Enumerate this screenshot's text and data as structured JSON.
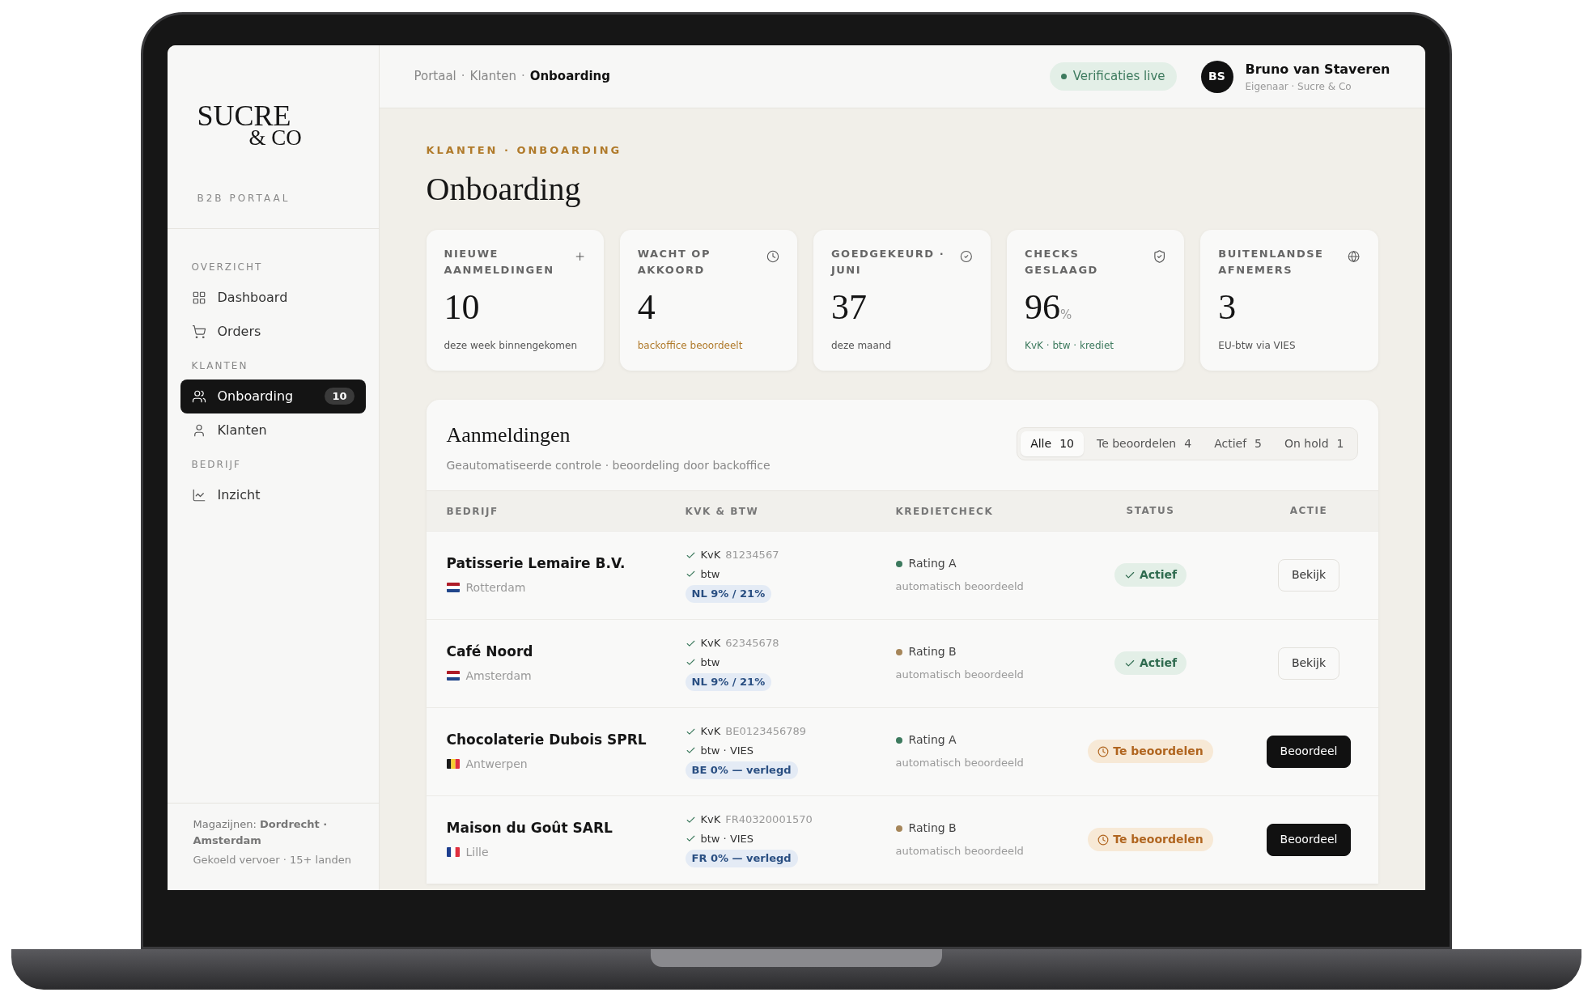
{
  "logo": {
    "line1": "SUCRE",
    "line2": "& CO"
  },
  "portal_label": "B2B PORTAAL",
  "sidebar": {
    "sections": [
      {
        "heading": "OVERZICHT",
        "items": [
          {
            "label": "Dashboard",
            "selected": false
          },
          {
            "label": "Orders",
            "selected": false
          }
        ]
      },
      {
        "heading": "KLANTEN",
        "items": [
          {
            "label": "Onboarding",
            "selected": true,
            "badge": "10"
          },
          {
            "label": "Klanten",
            "selected": false
          }
        ]
      },
      {
        "heading": "BEDRIJF",
        "items": [
          {
            "label": "Inzicht",
            "selected": false
          }
        ]
      }
    ],
    "footer": {
      "text": "Magazijnen: **Dordrecht · Amsterdam**",
      "subtext": "Gekoeld vervoer · 15+ landen"
    }
  },
  "header": {
    "breadcrumb": {
      "separator": "·",
      "items": [
        {
          "label": "Portaal",
          "current": false
        },
        {
          "label": "Klanten",
          "current": false
        },
        {
          "label": "Onboarding",
          "current": true
        }
      ]
    },
    "status_pill": "Verificaties live",
    "user": {
      "initials": "BS",
      "name": "Bruno van Staveren",
      "role": "Eigenaar · Sucre & Co"
    }
  },
  "page": {
    "eyebrow": "KLANTEN · ONBOARDING",
    "title": "Onboarding"
  },
  "stats": [
    {
      "label": "NIEUWE AANMELDINGEN",
      "value": "10",
      "note": "deze week binnengekomen",
      "kind": "muted"
    },
    {
      "label": "WACHT OP AKKOORD",
      "value": "4",
      "note": "backoffice beoordeelt",
      "kind": "warning"
    },
    {
      "label": "GOEDGEKEURD · JUNI",
      "value": "37",
      "note": "deze maand",
      "kind": "muted"
    },
    {
      "label": "CHECKS GESLAAGD",
      "value": "96",
      "unit": "%",
      "note": "KvK · btw · krediet",
      "kind": "success"
    },
    {
      "label": "BUITENLANDSE AFNEMERS",
      "value": "3",
      "note": "EU-btw via VIES",
      "kind": "muted"
    }
  ],
  "table": {
    "title": "Aanmeldingen",
    "subtitle": "Geautomatiseerde controle · beoordeling door backoffice",
    "filters": [
      {
        "label": "Alle",
        "count": "10",
        "selected": true
      },
      {
        "label": "Te beoordelen",
        "count": "4",
        "selected": false
      },
      {
        "label": "Actief",
        "count": "5",
        "selected": false
      },
      {
        "label": "On hold",
        "count": "1",
        "selected": false
      }
    ],
    "columns": [
      "BEDRIJF",
      "KVK & BTW",
      "KREDIETCHECK",
      "STATUS",
      "ACTIE"
    ],
    "rows": [
      {
        "company": "Patisserie Lemaire B.V.",
        "flag": {
          "kind": "nl"
        },
        "city": "Rotterdam",
        "kvk_label": "KvK",
        "kvk": "81234567",
        "btw": "btw",
        "vat_tag": "NL 9% / 21%",
        "rating": "Rating A",
        "color": "#3d7a5e",
        "rating_note": "automatisch beoordeeld",
        "status": {
          "label": "Actief",
          "kind": "active"
        },
        "action": {
          "label": "Bekijk",
          "kind": "secondary"
        }
      },
      {
        "company": "Café Noord",
        "flag": {
          "kind": "nl"
        },
        "city": "Amsterdam",
        "kvk_label": "KvK",
        "kvk": "62345678",
        "btw": "btw",
        "vat_tag": "NL 9% / 21%",
        "rating": "Rating B",
        "color": "#a6865a",
        "rating_note": "automatisch beoordeeld",
        "status": {
          "label": "Actief",
          "kind": "active"
        },
        "action": {
          "label": "Bekijk",
          "kind": "secondary"
        }
      },
      {
        "company": "Chocolaterie Dubois SPRL",
        "flag": {
          "kind": "be"
        },
        "city": "Antwerpen",
        "kvk_label": "KvK",
        "kvk": "BE0123456789",
        "btw": "btw · VIES",
        "vat_tag": "BE 0% — verlegd",
        "rating": "Rating A",
        "color": "#3d7a5e",
        "rating_note": "automatisch beoordeeld",
        "status": {
          "label": "Te beoordelen",
          "kind": "review"
        },
        "action": {
          "label": "Beoordeel",
          "kind": "primary"
        }
      },
      {
        "company": "Maison du Goût SARL",
        "flag": {
          "kind": "fr"
        },
        "city": "Lille",
        "kvk_label": "KvK",
        "kvk": "FR40320001570",
        "btw": "btw · VIES",
        "vat_tag": "FR 0% — verlegd",
        "rating": "Rating B",
        "color": "#a6865a",
        "rating_note": "automatisch beoordeeld",
        "status": {
          "label": "Te beoordelen",
          "kind": "review"
        },
        "action": {
          "label": "Beoordeel",
          "kind": "primary"
        }
      }
    ]
  }
}
